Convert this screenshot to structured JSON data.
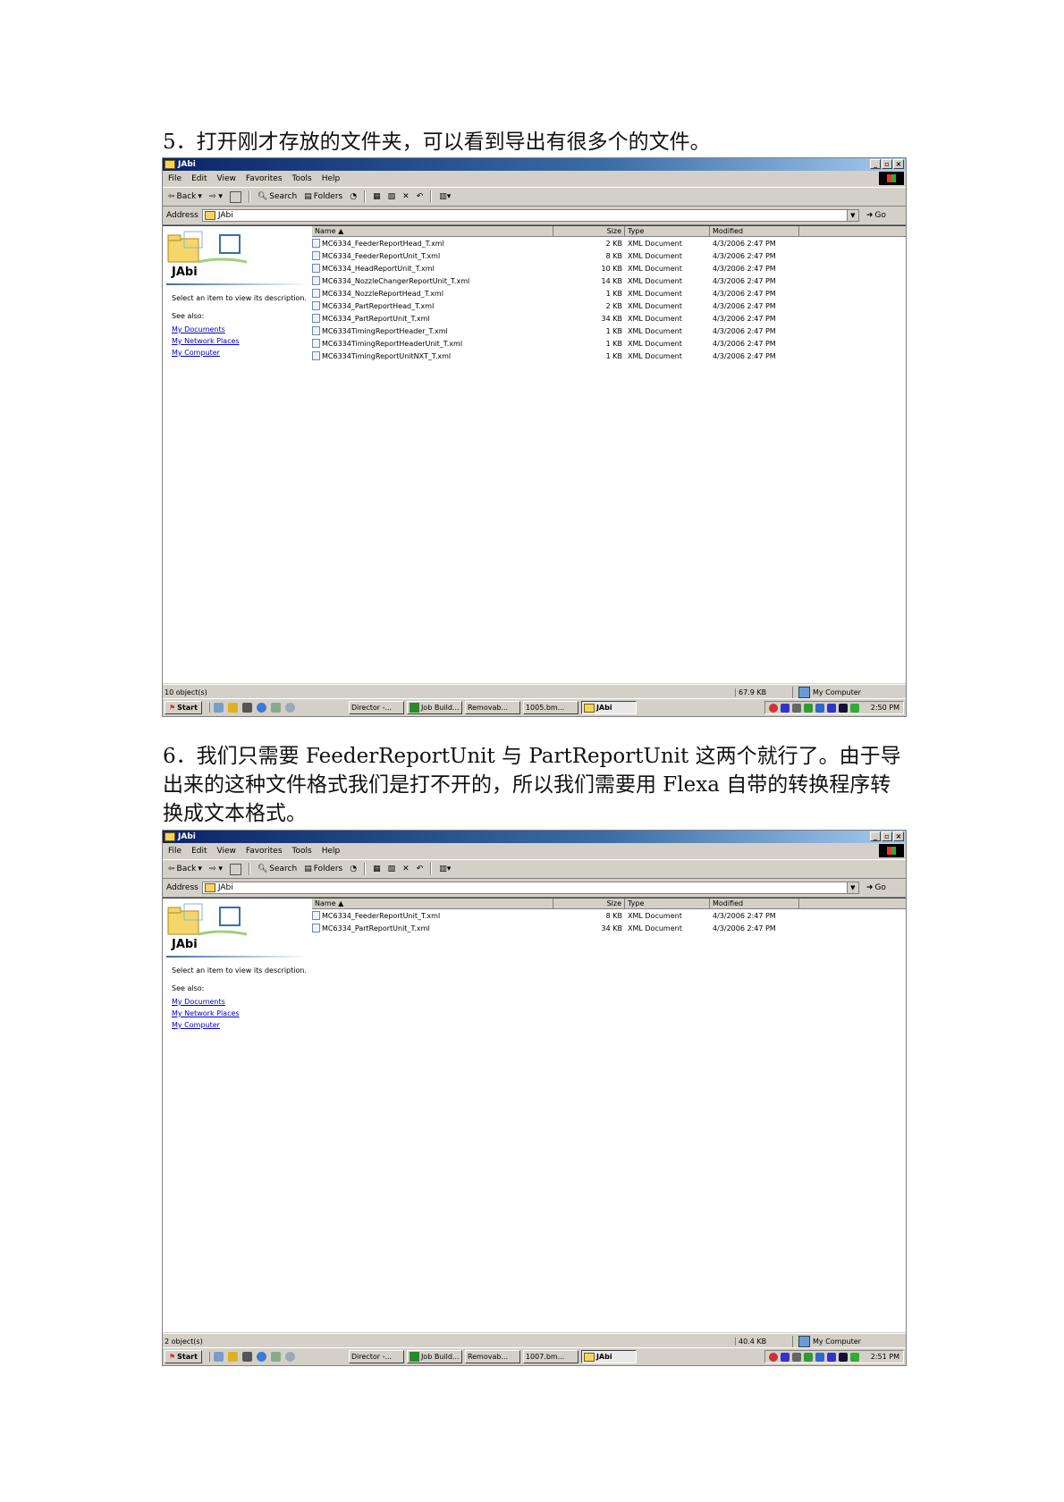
{
  "captions": {
    "step5": "5．打开刚才存放的文件夹，可以看到导出有很多个的文件。",
    "step6": "6．我们只需要 FeederReportUnit 与 PartReportUnit 这两个就行了。由于导出来的这种文件格式我们是打不开的，所以我们需要用 Flexa 自带的转换程序转换成文本格式。"
  },
  "explorer": {
    "title": "JAbi",
    "menu": [
      "File",
      "Edit",
      "View",
      "Favorites",
      "Tools",
      "Help"
    ],
    "toolbar": {
      "back": "Back",
      "search": "Search",
      "folders": "Folders"
    },
    "address_label": "Address",
    "address_value": "JAbi",
    "go_label": "Go",
    "pane": {
      "title": "JAbi",
      "description": "Select an item to view its description.",
      "see_also": "See also:",
      "links": [
        "My Documents",
        "My Network Places",
        "My Computer"
      ]
    },
    "columns": {
      "name": "Name",
      "size": "Size",
      "type": "Type",
      "modified": "Modified"
    },
    "taskbar": {
      "start": "Start",
      "tasks": [
        "Director -...",
        "Job Build...",
        "Removab...",
        "JAbi"
      ]
    },
    "computer_label": "My Computer"
  },
  "window1": {
    "files": [
      {
        "name": "MC6334_FeederReportHead_T.xml",
        "size": "2 KB",
        "type": "XML Document",
        "modified": "4/3/2006 2:47 PM"
      },
      {
        "name": "MC6334_FeederReportUnit_T.xml",
        "size": "8 KB",
        "type": "XML Document",
        "modified": "4/3/2006 2:47 PM"
      },
      {
        "name": "MC6334_HeadReportUnit_T.xml",
        "size": "10 KB",
        "type": "XML Document",
        "modified": "4/3/2006 2:47 PM"
      },
      {
        "name": "MC6334_NozzleChangerReportUnit_T.xml",
        "size": "14 KB",
        "type": "XML Document",
        "modified": "4/3/2006 2:47 PM"
      },
      {
        "name": "MC6334_NozzleReportHead_T.xml",
        "size": "1 KB",
        "type": "XML Document",
        "modified": "4/3/2006 2:47 PM"
      },
      {
        "name": "MC6334_PartReportHead_T.xml",
        "size": "2 KB",
        "type": "XML Document",
        "modified": "4/3/2006 2:47 PM"
      },
      {
        "name": "MC6334_PartReportUnit_T.xml",
        "size": "34 KB",
        "type": "XML Document",
        "modified": "4/3/2006 2:47 PM"
      },
      {
        "name": "MC6334TimingReportHeader_T.xml",
        "size": "1 KB",
        "type": "XML Document",
        "modified": "4/3/2006 2:47 PM"
      },
      {
        "name": "MC6334TimingReportHeaderUnit_T.xml",
        "size": "1 KB",
        "type": "XML Document",
        "modified": "4/3/2006 2:47 PM"
      },
      {
        "name": "MC6334TimingReportUnitNXT_T.xml",
        "size": "1 KB",
        "type": "XML Document",
        "modified": "4/3/2006 2:47 PM"
      }
    ],
    "status_objects": "10 object(s)",
    "status_size": "67.9 KB",
    "task_bm": "1005.bm...",
    "clock": "2:50 PM"
  },
  "window2": {
    "files": [
      {
        "name": "MC6334_FeederReportUnit_T.xml",
        "size": "8 KB",
        "type": "XML Document",
        "modified": "4/3/2006 2:47 PM"
      },
      {
        "name": "MC6334_PartReportUnit_T.xml",
        "size": "34 KB",
        "type": "XML Document",
        "modified": "4/3/2006 2:47 PM"
      }
    ],
    "status_objects": "2 object(s)",
    "status_size": "40.4 KB",
    "task_bm": "1007.bm...",
    "clock": "2:51 PM"
  }
}
